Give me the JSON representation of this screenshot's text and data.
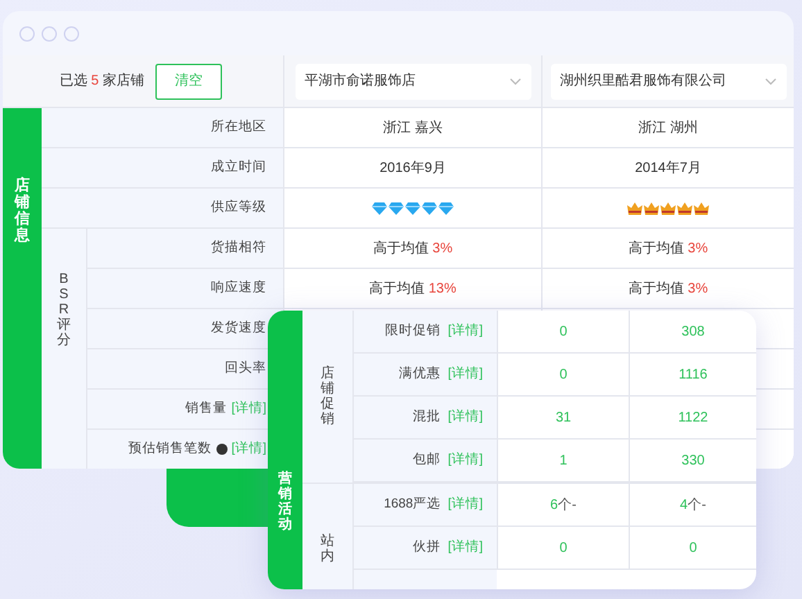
{
  "selection": {
    "prefix": "已选",
    "count": "5",
    "suffix": "家店铺",
    "clear_button": "清空"
  },
  "shops": [
    {
      "name": "平湖市俞诺服饰店"
    },
    {
      "name": "湖州织里酷君服饰有限公司"
    }
  ],
  "shop_info": {
    "group": "店铺信息",
    "rows": [
      {
        "label": "所在地区",
        "values": [
          {
            "kind": "text",
            "text": "浙江 嘉兴"
          },
          {
            "kind": "text",
            "text": "浙江 湖州"
          }
        ]
      },
      {
        "label": "成立时间",
        "values": [
          {
            "kind": "text",
            "text": "2016年9月"
          },
          {
            "kind": "text",
            "text": "2014年7月"
          }
        ]
      },
      {
        "label": "供应等级",
        "values": [
          {
            "kind": "diamond",
            "stars": 5
          },
          {
            "kind": "crown",
            "stars": 5
          }
        ]
      }
    ],
    "bsr": {
      "group": "BSR评分",
      "rows": [
        {
          "label": "货描相符",
          "values": [
            {
              "kind": "text",
              "text": "高于均值",
              "highlight": "3%"
            },
            {
              "kind": "text",
              "text": "高于均值",
              "highlight": "3%"
            }
          ]
        },
        {
          "label": "响应速度",
          "values": [
            {
              "kind": "text",
              "text": "高于均值",
              "highlight": "13%"
            },
            {
              "kind": "text",
              "text": "高于均值",
              "highlight": "3%"
            }
          ]
        },
        {
          "label": "发货速度",
          "values": []
        },
        {
          "label": "回头率",
          "values": []
        }
      ]
    }
  },
  "sales": {
    "rows": [
      {
        "label": "销售量",
        "help": false,
        "link": "[详情]"
      },
      {
        "label": "预估销售笔数",
        "help": true,
        "link": "[详情]"
      }
    ]
  },
  "marketing": {
    "group": "营销活动",
    "sections": [
      {
        "title": "店铺促销",
        "rows": [
          {
            "label": "限时促销",
            "link": "[详情]",
            "values": [
              {
                "value": "0"
              },
              {
                "value": "308"
              }
            ]
          },
          {
            "label": "满优惠",
            "link": "[详情]",
            "values": [
              {
                "value": "0"
              },
              {
                "value": "1116"
              }
            ]
          },
          {
            "label": "混批",
            "link": "[详情]",
            "values": [
              {
                "value": "31"
              },
              {
                "value": "1122"
              }
            ]
          },
          {
            "label": "包邮",
            "link": "[详情]",
            "values": [
              {
                "value": "1"
              },
              {
                "value": "330"
              }
            ]
          }
        ]
      },
      {
        "title": "站内",
        "rows": [
          {
            "label": "1688严选",
            "link": "[详情]",
            "values": [
              {
                "value": "6",
                "suffix": "个-"
              },
              {
                "value": "4",
                "suffix": "个-"
              }
            ]
          },
          {
            "label": "伙拼",
            "link": "[详情]",
            "values": [
              {
                "value": "0"
              },
              {
                "value": "0"
              }
            ]
          }
        ]
      }
    ]
  }
}
